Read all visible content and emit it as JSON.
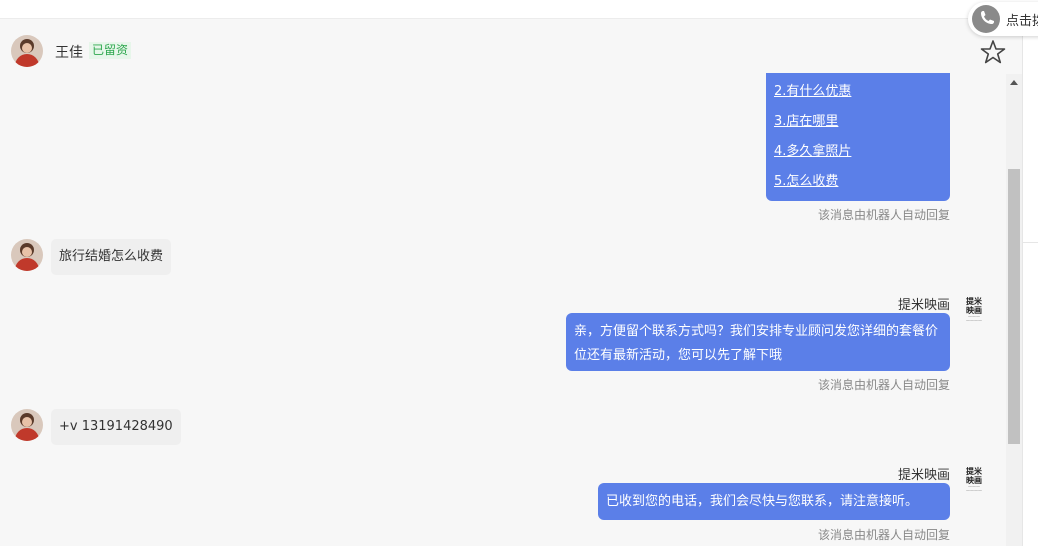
{
  "header": {
    "contact_name": "王佳",
    "status_badge": "已留资"
  },
  "call_button": {
    "label": "点击拨"
  },
  "messages": {
    "menu": {
      "items": [
        "2.有什么优惠",
        "3.店在哪里",
        "4.多久拿照片",
        "5.怎么收费"
      ],
      "auto_note": "该消息由机器人自动回复"
    },
    "m1": {
      "text": "旅行结婚怎么收费"
    },
    "m2": {
      "sender": "提米映画",
      "text": "亲，方便留个联系方式吗？我们安排专业顾问发您详细的套餐价位还有最新活动，您可以先了解下哦",
      "auto_note": "该消息由机器人自动回复"
    },
    "m3": {
      "text": "+v 13191428490"
    },
    "m4": {
      "sender": "提米映画",
      "text": "已收到您的电话，我们会尽快与您联系，请注意接听。",
      "auto_note": "该消息由机器人自动回复"
    }
  },
  "logo": {
    "line1": "提米",
    "line2": "映画",
    "small": "——— ————"
  },
  "colors": {
    "outgoing_bubble": "#5b7fe8",
    "incoming_bubble": "#efefef",
    "badge_text": "#2fa84f",
    "background": "#f7f7f7"
  },
  "icons": {
    "call": "phone-icon",
    "favorite": "star-icon",
    "scroll_up": "chevron-up-icon"
  }
}
